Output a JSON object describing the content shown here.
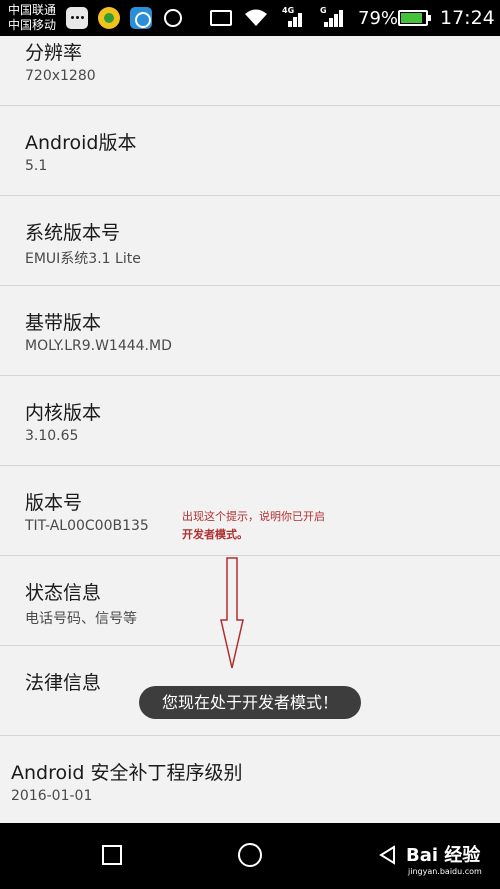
{
  "status_bar": {
    "carrier_line1": "中国联通",
    "carrier_line2": "中国移动",
    "net_4g": "4G",
    "net_g": "G",
    "battery_percent": "79%",
    "battery_level": 0.79,
    "time": "17:24",
    "icons": [
      "message-icon",
      "game-icon",
      "browser-icon",
      "chat-icon",
      "screencast-icon",
      "wifi-icon",
      "signal-icon",
      "battery-icon"
    ]
  },
  "items": [
    {
      "title": "分辨率",
      "sub": "720x1280"
    },
    {
      "title": "Android版本",
      "sub": "5.1"
    },
    {
      "title": "系统版本号",
      "sub": "EMUI系统3.1 Lite"
    },
    {
      "title": "基带版本",
      "sub": "MOLY.LR9.W1444.MD"
    },
    {
      "title": "内核版本",
      "sub": "3.10.65"
    },
    {
      "title": "版本号",
      "sub": "TIT-AL00C00B135"
    },
    {
      "title": "状态信息",
      "sub": "电话号码、信号等"
    },
    {
      "title": "法律信息",
      "sub": ""
    },
    {
      "title": "Android 安全补丁程序级别",
      "sub": "2016-01-01"
    }
  ],
  "toast": "您现在处于开发者模式！",
  "annotation": {
    "line1": "出现这个提示，说明你已开启",
    "line2": "开发者模式。",
    "color": "#b03030"
  },
  "watermark": {
    "text": "Bai 经验",
    "url": "jingyan.baidu.com"
  },
  "navbar": {
    "icons": [
      "recent-apps-icon",
      "home-icon",
      "back-icon"
    ]
  }
}
